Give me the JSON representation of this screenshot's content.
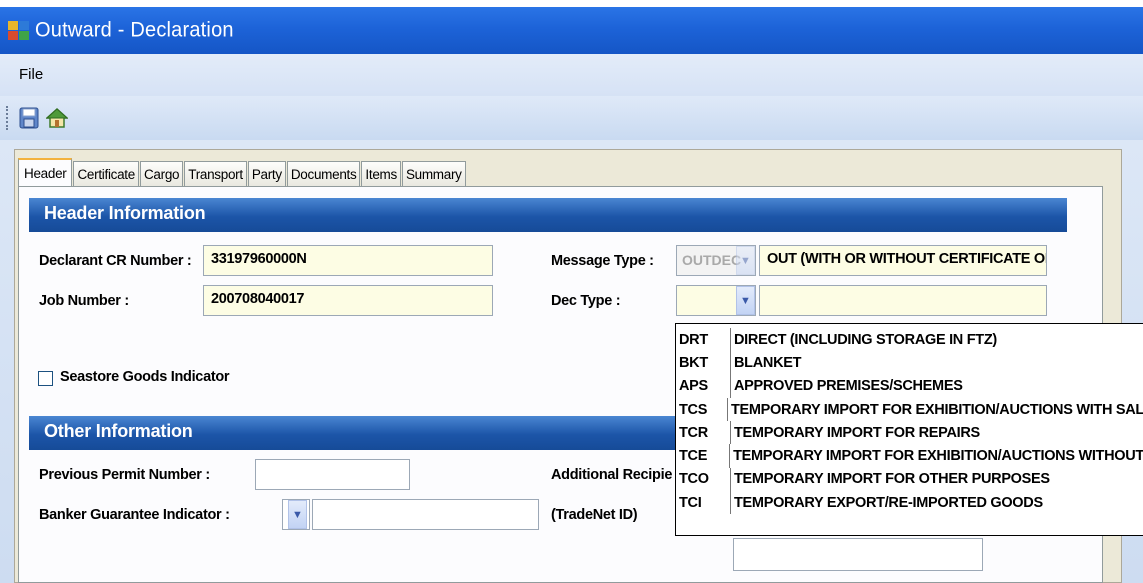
{
  "window": {
    "title": "Outward - Declaration"
  },
  "menu": {
    "file_label": "File"
  },
  "toolbar": {
    "save_icon": "save-icon",
    "home_icon": "home-icon"
  },
  "tabs": [
    {
      "label": "Header",
      "active": true
    },
    {
      "label": "Certificate"
    },
    {
      "label": "Cargo"
    },
    {
      "label": "Transport"
    },
    {
      "label": "Party"
    },
    {
      "label": "Documents"
    },
    {
      "label": "Items"
    },
    {
      "label": "Summary"
    }
  ],
  "header_info": {
    "title": "Header Information",
    "declarant_cr_label": "Declarant CR Number :",
    "declarant_cr_value": "33197960000N",
    "job_number_label": "Job Number :",
    "job_number_value": "200708040017",
    "message_type_label": "Message Type :",
    "message_type_code": "OUTDEC",
    "message_type_desc": "OUT (WITH OR WITHOUT CERTIFICATE OF (",
    "dec_type_label": "Dec Type :",
    "dec_type_code": "",
    "dec_type_desc": "",
    "seastore_label": "Seastore Goods Indicator",
    "seastore_checked": false
  },
  "other_info": {
    "title": "Other Information",
    "prev_permit_label": "Previous Permit Number :",
    "prev_permit_value": "",
    "banker_guarantee_label": "Banker Guarantee Indicator :",
    "banker_guarantee_code": "",
    "banker_guarantee_desc": "",
    "additional_recipient_label": "Additional Recipie",
    "tradenet_label": "(TradeNet ID)"
  },
  "dec_type_options": [
    {
      "code": "DRT",
      "desc": "DIRECT (INCLUDING STORAGE IN FTZ)"
    },
    {
      "code": "BKT",
      "desc": "BLANKET"
    },
    {
      "code": "APS",
      "desc": "APPROVED PREMISES/SCHEMES"
    },
    {
      "code": "TCS",
      "desc": "TEMPORARY IMPORT FOR EXHIBITION/AUCTIONS WITH SAL"
    },
    {
      "code": "TCR",
      "desc": "TEMPORARY IMPORT FOR REPAIRS"
    },
    {
      "code": "TCE",
      "desc": "TEMPORARY IMPORT FOR EXHIBITION/AUCTIONS WITHOUT"
    },
    {
      "code": "TCO",
      "desc": "TEMPORARY IMPORT FOR OTHER PURPOSES"
    },
    {
      "code": "TCI",
      "desc": "TEMPORARY EXPORT/RE-IMPORTED GOODS"
    }
  ],
  "colors": {
    "titlebar": "#1d63d8",
    "section_header": "#1c55a8",
    "field_bg": "#fdfde4",
    "tab_active_accent": "#f3b23c"
  }
}
